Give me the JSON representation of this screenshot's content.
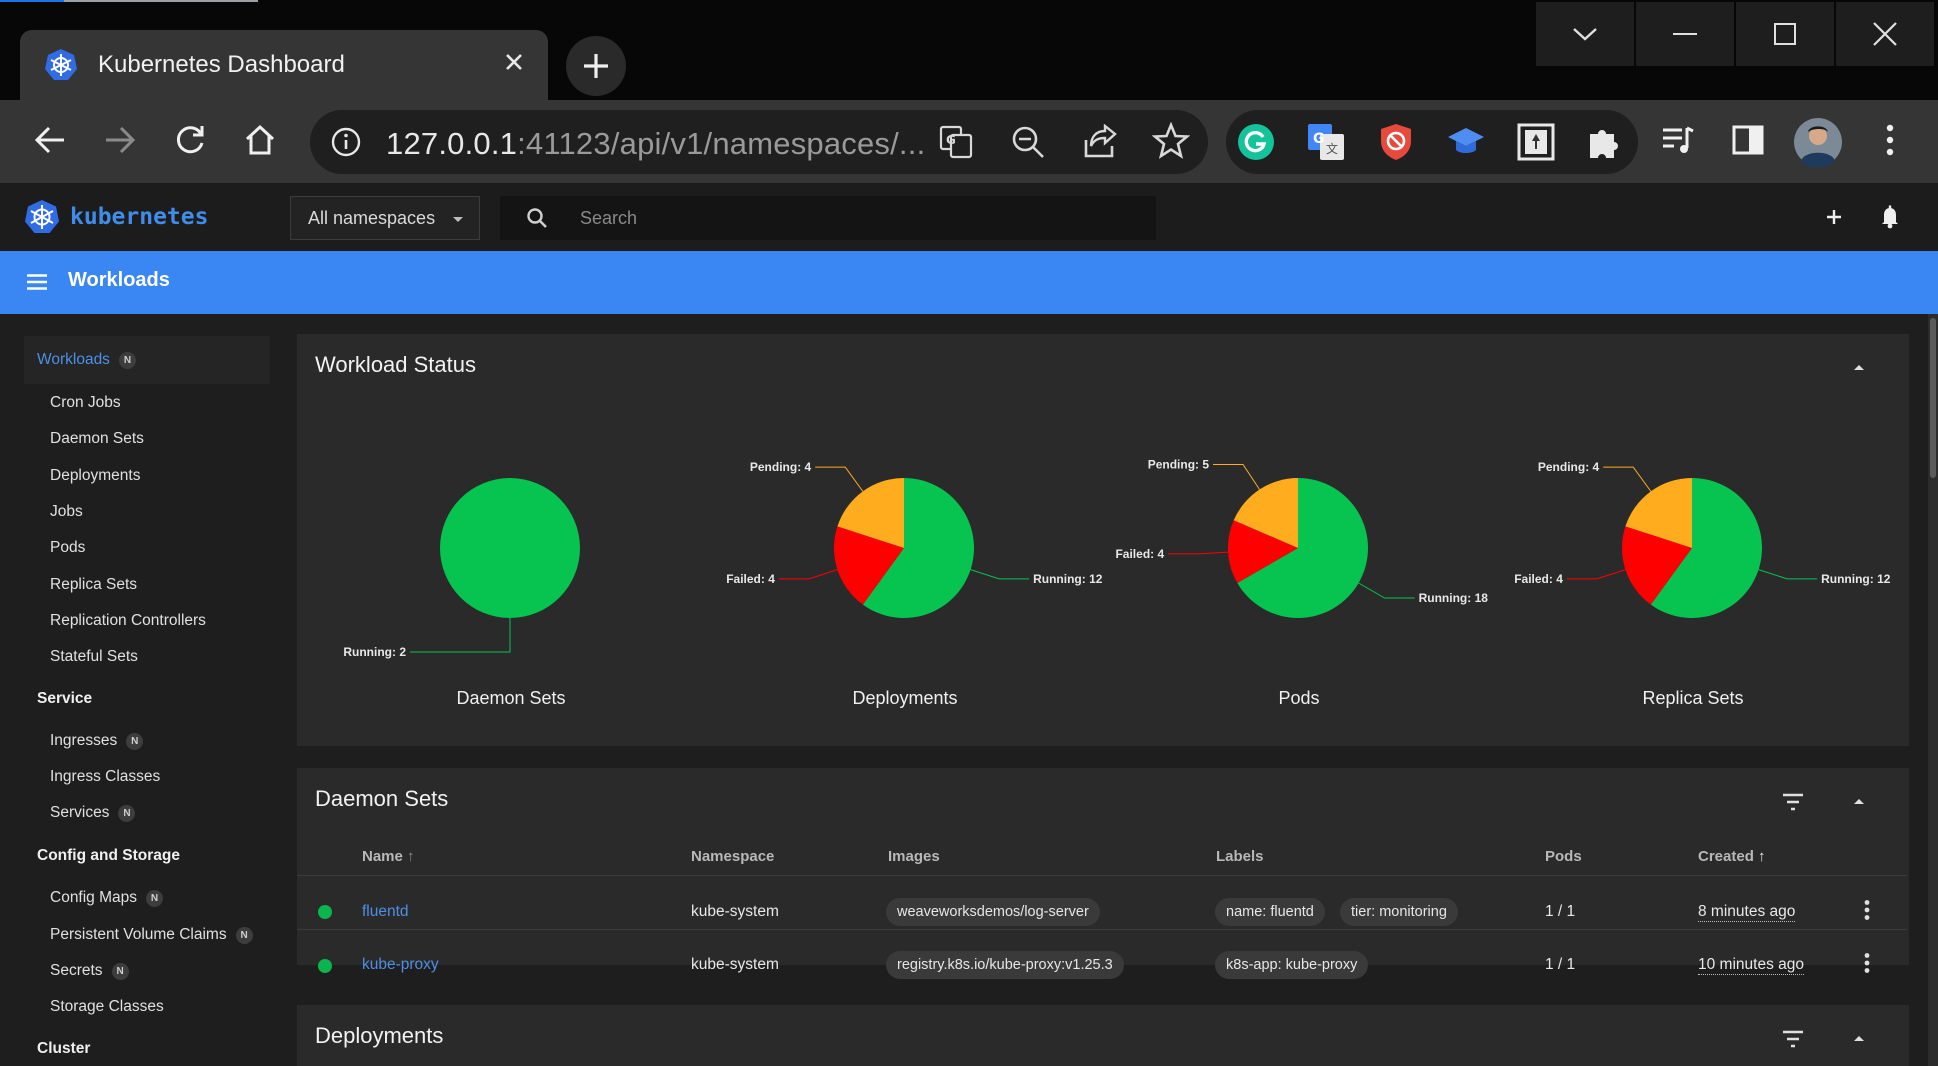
{
  "browser": {
    "tab_title": "Kubernetes Dashboard",
    "url_host": "127.0.0.1",
    "url_rest": ":41123/api/v1/namespaces/..."
  },
  "dashboard": {
    "brand": "kubernetes",
    "namespace_select": "All namespaces",
    "search_placeholder": "Search",
    "header_title": "Workloads"
  },
  "sidebar": {
    "workloads": {
      "label": "Workloads",
      "badge": "N"
    },
    "workload_items": [
      "Cron Jobs",
      "Daemon Sets",
      "Deployments",
      "Jobs",
      "Pods",
      "Replica Sets",
      "Replication Controllers",
      "Stateful Sets"
    ],
    "service": {
      "label": "Service"
    },
    "service_items": [
      {
        "label": "Ingresses",
        "badge": "N"
      },
      {
        "label": "Ingress Classes",
        "badge": ""
      },
      {
        "label": "Services",
        "badge": "N"
      }
    ],
    "config": {
      "label": "Config and Storage"
    },
    "config_items": [
      {
        "label": "Config Maps",
        "badge": "N"
      },
      {
        "label": "Persistent Volume Claims",
        "badge": "N"
      },
      {
        "label": "Secrets",
        "badge": "N"
      },
      {
        "label": "Storage Classes",
        "badge": ""
      }
    ],
    "cluster": {
      "label": "Cluster"
    }
  },
  "workload_status": {
    "title": "Workload Status"
  },
  "chart_data": [
    {
      "type": "pie",
      "title": "Daemon Sets",
      "slices": [
        {
          "label": "Running",
          "value": 2,
          "color": "#06c44f"
        }
      ]
    },
    {
      "type": "pie",
      "title": "Deployments",
      "slices": [
        {
          "label": "Running",
          "value": 12,
          "color": "#06c44f"
        },
        {
          "label": "Failed",
          "value": 4,
          "color": "#ff0000"
        },
        {
          "label": "Pending",
          "value": 4,
          "color": "#ffad1f"
        }
      ]
    },
    {
      "type": "pie",
      "title": "Pods",
      "slices": [
        {
          "label": "Running",
          "value": 18,
          "color": "#06c44f"
        },
        {
          "label": "Failed",
          "value": 4,
          "color": "#ff0000"
        },
        {
          "label": "Pending",
          "value": 5,
          "color": "#ffad1f"
        }
      ]
    },
    {
      "type": "pie",
      "title": "Replica Sets",
      "slices": [
        {
          "label": "Running",
          "value": 12,
          "color": "#06c44f"
        },
        {
          "label": "Failed",
          "value": 4,
          "color": "#ff0000"
        },
        {
          "label": "Pending",
          "value": 4,
          "color": "#ffad1f"
        }
      ]
    }
  ],
  "daemon_sets": {
    "title": "Daemon Sets",
    "columns": {
      "name": "Name",
      "namespace": "Namespace",
      "images": "Images",
      "labels": "Labels",
      "pods": "Pods",
      "created": "Created"
    },
    "rows": [
      {
        "name": "fluentd",
        "namespace": "kube-system",
        "image": "weaveworksdemos/log-server",
        "labels": [
          "name: fluentd",
          "tier: monitoring"
        ],
        "pods": "1 / 1",
        "created": "8 minutes ago"
      },
      {
        "name": "kube-proxy",
        "namespace": "kube-system",
        "image": "registry.k8s.io/kube-proxy:v1.25.3",
        "labels": [
          "k8s-app: kube-proxy"
        ],
        "pods": "1 / 1",
        "created": "10 minutes ago"
      }
    ]
  },
  "deployments": {
    "title": "Deployments"
  }
}
